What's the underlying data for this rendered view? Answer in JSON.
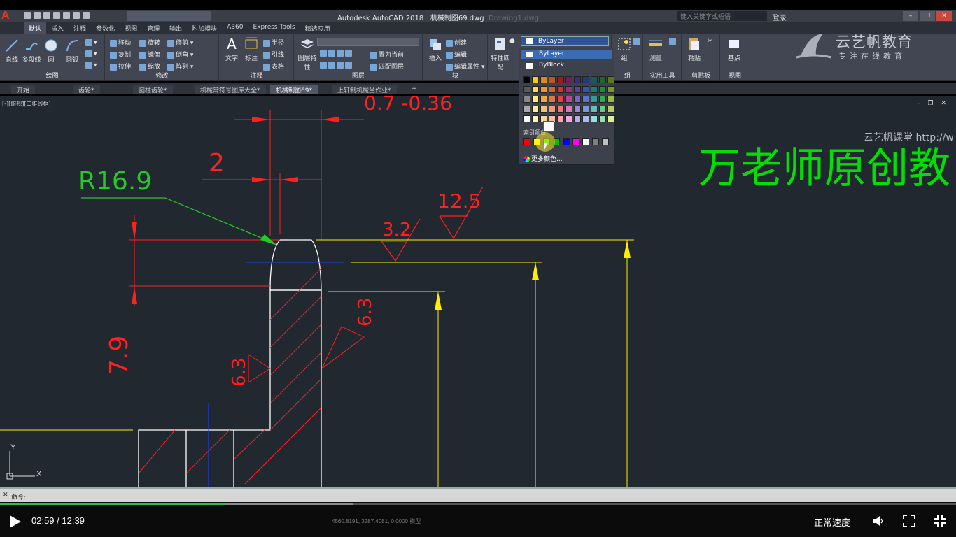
{
  "titlebar": {
    "app_title": "Autodesk AutoCAD 2018",
    "filename": "机械制图69.dwg",
    "filename_ghost": "Drawing1.dwg",
    "search_placeholder": "键入关键字或短语",
    "login": "登录"
  },
  "ribbon_tabs": [
    "默认",
    "插入",
    "注释",
    "参数化",
    "视图",
    "管理",
    "输出",
    "附加模块",
    "A360",
    "Express Tools",
    "精选应用"
  ],
  "ribbon": {
    "draw": {
      "title": "绘图",
      "line": "直线",
      "polyline": "多段线",
      "circle": "圆",
      "arc": "圆弧"
    },
    "modify": {
      "title": "修改",
      "move": "移动",
      "rotate": "旋转",
      "trim": "修剪",
      "copy": "复制",
      "mirror": "镜像",
      "fillet": "倒角",
      "stretch": "拉伸",
      "scale": "缩放",
      "array": "阵列"
    },
    "annotation": {
      "title": "注释",
      "text": "文字",
      "dimension": "标注",
      "radius": "半径",
      "leader": "引线",
      "table": "表格"
    },
    "layers": {
      "title": "图层",
      "layer_props": "图层特性",
      "make_current": "置为当前",
      "match_layer": "匹配图层"
    },
    "block": {
      "title": "块",
      "insert": "插入",
      "create": "创建",
      "edit": "编辑",
      "edit_attr": "编辑属性"
    },
    "properties": {
      "match": "特性匹配",
      "color_value": "ByLayer"
    },
    "groups": {
      "title": "组",
      "group": "组"
    },
    "utilities": {
      "title": "实用工具",
      "measure": "测量"
    },
    "clipboard": {
      "title": "剪贴板",
      "paste": "粘贴"
    },
    "view": {
      "title": "视图",
      "base": "基点"
    }
  },
  "color_dropdown": {
    "selected": "ByLayer",
    "options": [
      "ByLayer",
      "ByBlock"
    ],
    "index_label": "索引颜色:",
    "more_colors": "更多颜色...",
    "palette": [
      [
        "#000000",
        "#ffcc00",
        "#d98c1a",
        "#b85a1a",
        "#a31a1a",
        "#7a1a5a",
        "#3a2a8a",
        "#1a3a8a",
        "#1a5a5a",
        "#1a6a2a",
        "#5a7a1a"
      ],
      [
        "#5a5a5a",
        "#ffdd44",
        "#e69a33",
        "#cc6633",
        "#cc3333",
        "#993377",
        "#5544aa",
        "#3355aa",
        "#227777",
        "#228844",
        "#779933"
      ],
      [
        "#888888",
        "#ffee77",
        "#f0a844",
        "#dd7744",
        "#dd4444",
        "#bb4499",
        "#7766cc",
        "#5577cc",
        "#339999",
        "#33aa55",
        "#99bb44"
      ],
      [
        "#aaaaaa",
        "#ffee99",
        "#f4c077",
        "#ee9977",
        "#ee7777",
        "#dd77bb",
        "#9988dd",
        "#7799dd",
        "#66bbbb",
        "#66cc88",
        "#bbcc66"
      ],
      [
        "#ffffff",
        "#fff4bb",
        "#f8d8a0",
        "#f8c0a8",
        "#f8a8a8",
        "#eeaadd",
        "#bbaaee",
        "#aabbee",
        "#99dddd",
        "#99ddaa",
        "#ddee99"
      ]
    ],
    "index_colors": [
      "#ff0000",
      "#ffff00",
      "#00ff00",
      "#00c000",
      "#0000ff",
      "#ff00ff",
      "#ffffff",
      "#808080",
      "#c0c0c0"
    ]
  },
  "doc_tabs": [
    "开始",
    "齿轮*",
    "圆柱齿轮*",
    "机械常符号图库大全*",
    "机械制图69*",
    "上轩制机械坐作业*"
  ],
  "viewport_label": "[-][俯视][二维线框]",
  "watermark": {
    "brand": "云艺帆教育",
    "slogan": "专注在线教育",
    "overlay_text": "万老师原创教",
    "site_text": "云艺帆课堂 http://w"
  },
  "drawing": {
    "dims": [
      "0.7 -0.36",
      "2",
      "R16.9",
      "7.9",
      "3.2",
      "12.5",
      "6.3",
      "6.3"
    ],
    "ucs_x": "X",
    "ucs_y": "Y"
  },
  "command": {
    "prompt": "命令:"
  },
  "player": {
    "time": "02:59 / 12:39",
    "played_fraction": 0.236,
    "buffered_fraction": 0.37,
    "coords": "4560.8191, 3287.4081, 0.0000  模型",
    "speed": "正常速度"
  },
  "colors": {
    "red_dim": "#ff0000",
    "yellow_dim": "#ffff00",
    "green_text": "#00ee00",
    "accent_blue": "#3a6cb5"
  }
}
